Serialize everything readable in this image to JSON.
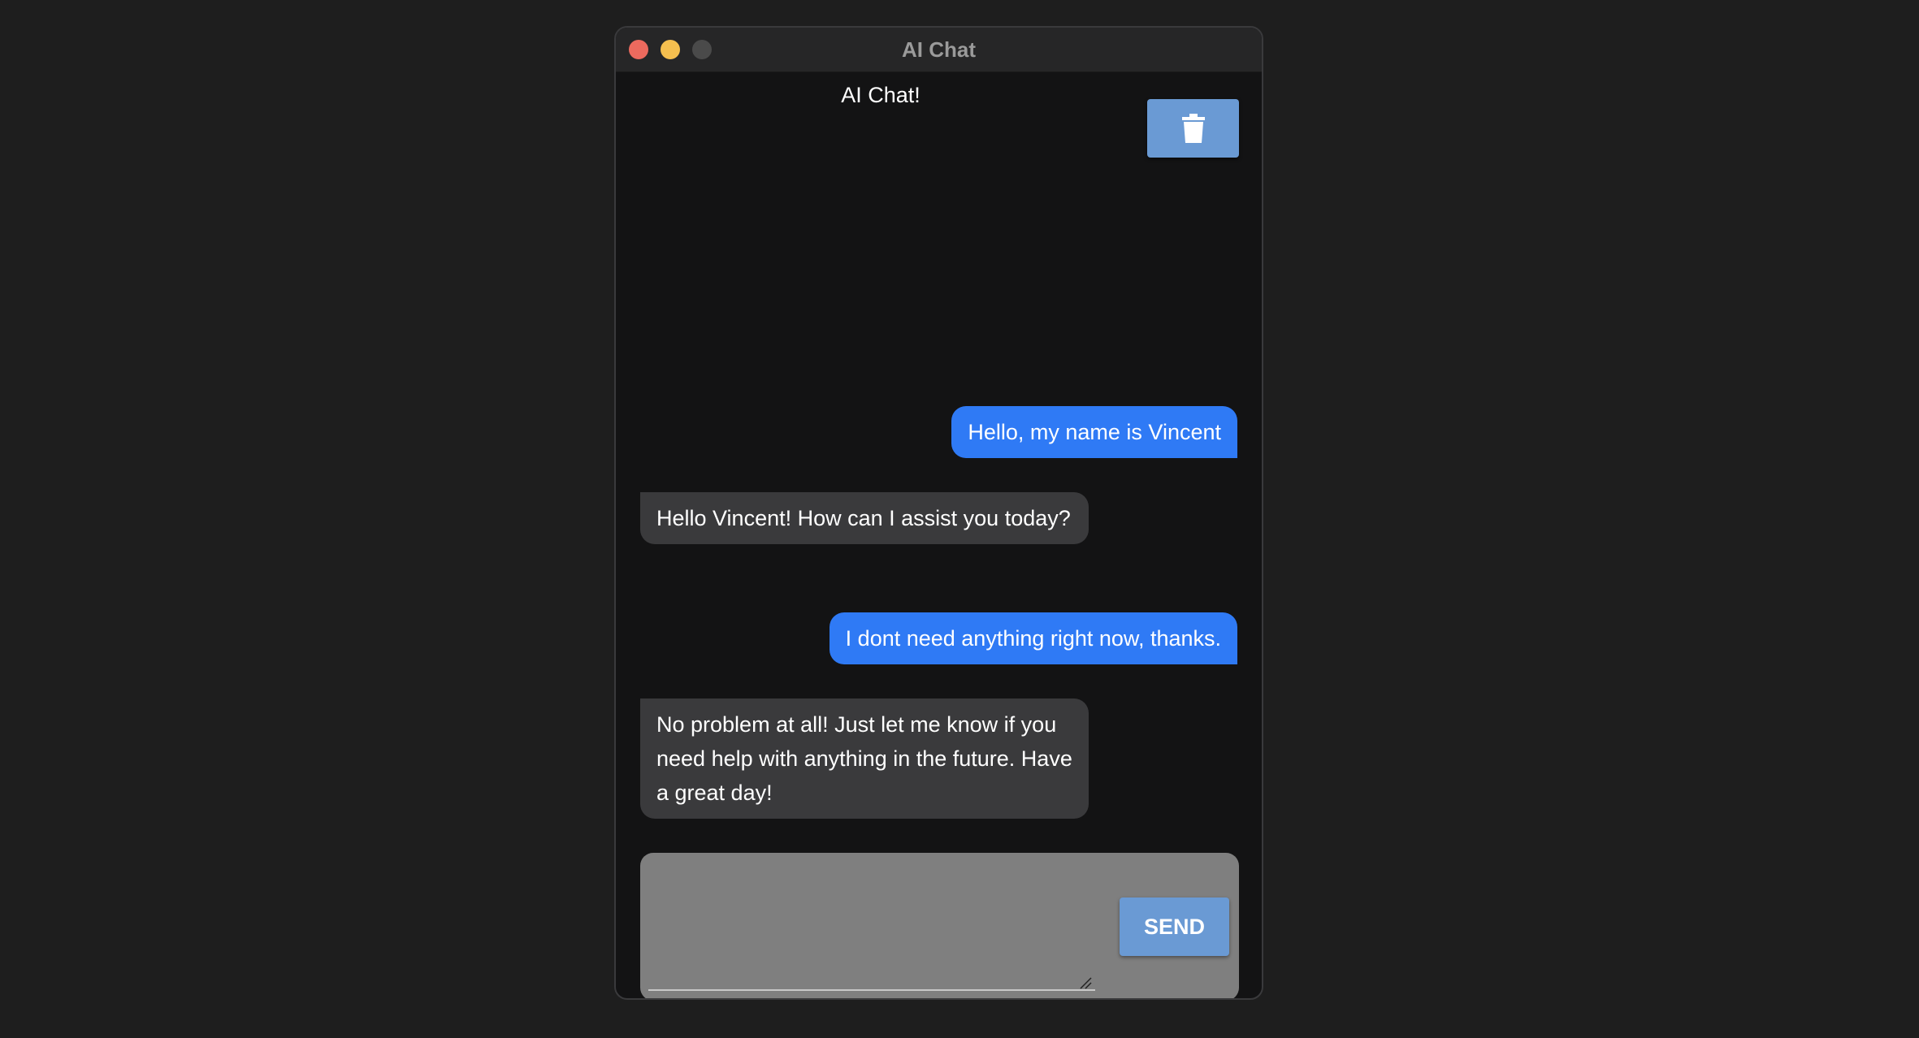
{
  "window": {
    "title": "AI Chat",
    "controls": {
      "close_color": "#ed6a5e",
      "minimize_color": "#f5bf4f",
      "maximize_color": "#4a4a4a"
    }
  },
  "header": {
    "title": "AI Chat!",
    "clear_icon": "trash-icon",
    "clear_button_color": "#6a9ad4"
  },
  "messages": [
    {
      "role": "user",
      "text": "Hello, my name is Vincent"
    },
    {
      "role": "assistant",
      "text": "Hello Vincent! How can I assist you today?"
    },
    {
      "role": "user",
      "text": "I dont need anything right now, thanks."
    },
    {
      "role": "assistant",
      "text": "No problem at all! Just let me know if you need help with anything in the future. Have a great day!"
    }
  ],
  "composer": {
    "value": "",
    "placeholder": "",
    "send_label": "SEND",
    "panel_color": "#7f7f7f",
    "send_button_color": "#6a9ad4"
  },
  "colors": {
    "user_bubble": "#2f7af5",
    "assistant_bubble": "#3a3a3c",
    "background": "#131314"
  }
}
